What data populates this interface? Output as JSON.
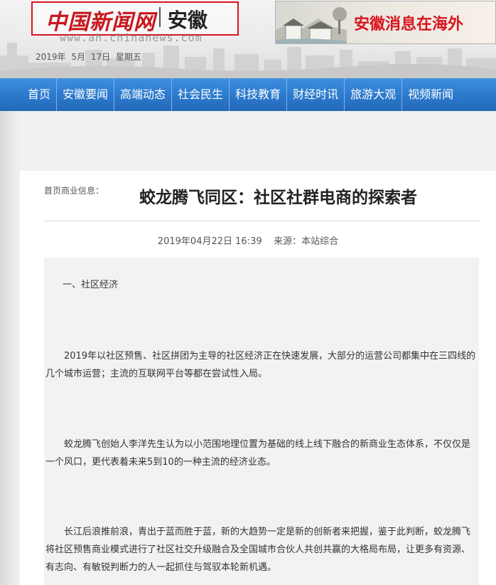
{
  "header": {
    "logo_cn": "中国新闻网",
    "logo_region": "安徽",
    "site_url": "www.ah.chinanews.com",
    "date": "2019年 5月 17日   星期五",
    "banner_text": "安徽消息在海外"
  },
  "nav": {
    "items": [
      "首页",
      "安徽要闻",
      "高端动态",
      "社会民生",
      "科技教育",
      "财经时讯",
      "旅游大观",
      "视频新闻"
    ]
  },
  "article": {
    "breadcrumb": "首页商业信息：",
    "title": "蛟龙腾飞同区：社区社群电商的探索者",
    "meta": "2019年04月22日 16:39    来源：本站综合",
    "paragraphs": [
      "一、社区经济",
      "2019年以社区预售、社区拼团为主导的社区经济正在快速发展，大部分的运营公司都集中在三四线的几个城市运营；主流的互联网平台等都在尝试性入局。",
      "蛟龙腾飞创始人李洋先生认为以小范围地理位置为基础的线上线下融合的新商业生态体系，不仅仅是一个风口，更代表着未来5到10的一种主流的经济业态。",
      "长江后浪推前浪，青出于蓝而胜于蓝，新的大趋势一定是新的创新者来把握，鉴于此判断，蛟龙腾飞将社区预售商业模式进行了社区社交升级融合及全国城市合伙人共创共赢的大格局布局，让更多有资源、有志向、有敏锐判断力的人一起抓住与驾驭本轮新机遇。"
    ]
  },
  "colors": {
    "accent_red": "#d9141f",
    "nav_blue": "#2c79cc"
  }
}
